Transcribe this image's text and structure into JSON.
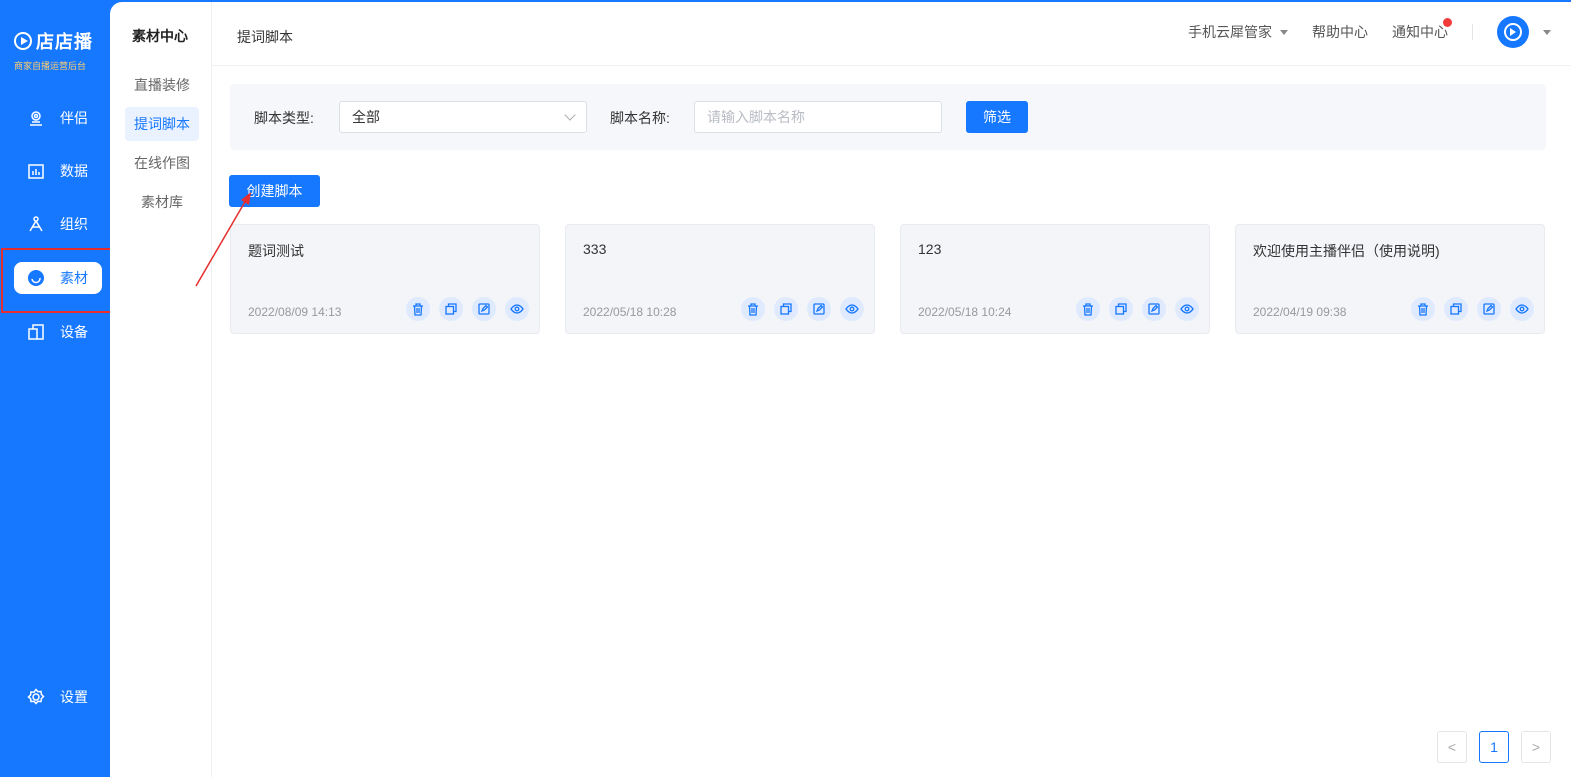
{
  "brand": {
    "name": "店店播",
    "subtitle": "商家自播运营后台"
  },
  "nav": {
    "items": [
      {
        "label": "伴侣",
        "icon": "partner-icon"
      },
      {
        "label": "数据",
        "icon": "data-icon"
      },
      {
        "label": "组织",
        "icon": "organization-icon"
      },
      {
        "label": "素材",
        "icon": "material-icon",
        "active": true
      },
      {
        "label": "设备",
        "icon": "device-icon"
      }
    ],
    "settings": {
      "label": "设置",
      "icon": "gear-icon"
    }
  },
  "subnav": {
    "title": "素材中心",
    "items": [
      {
        "label": "直播装修"
      },
      {
        "label": "提词脚本",
        "active": true
      },
      {
        "label": "在线作图"
      },
      {
        "label": "素材库"
      }
    ]
  },
  "topbar": {
    "page_title": "提词脚本",
    "cloud_steward": "手机云犀管家",
    "help_center": "帮助中心",
    "notifications": "通知中心"
  },
  "filter": {
    "type_label": "脚本类型:",
    "type_value": "全部",
    "name_label": "脚本名称:",
    "name_placeholder": "请输入脚本名称",
    "filter_button": "筛选"
  },
  "create_button": "创建脚本",
  "scripts": [
    {
      "title": "题词测试",
      "date": "2022/08/09 14:13"
    },
    {
      "title": "333",
      "date": "2022/05/18 10:28"
    },
    {
      "title": "123",
      "date": "2022/05/18 10:24"
    },
    {
      "title": "欢迎使用主播伴侣（使用说明)",
      "date": "2022/04/19 09:38"
    }
  ],
  "pagination": {
    "current": "1",
    "prev": "<",
    "next": ">"
  },
  "colors": {
    "primary": "#1677ff",
    "annotation": "#e62e2e"
  }
}
